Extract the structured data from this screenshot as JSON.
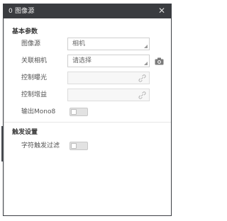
{
  "window": {
    "title": "0 图像源",
    "close_glyph": "✕",
    "titlebar_color": "#3a3c40"
  },
  "basic_params": {
    "section_title": "基本参数",
    "image_source": {
      "label": "图像源",
      "value": "相机"
    },
    "linked_camera": {
      "label": "关联相机",
      "value": "请选择",
      "action_icon": "camera-icon"
    },
    "exposure": {
      "label": "控制曝光",
      "value": "",
      "icon": "link-icon"
    },
    "gain": {
      "label": "控制增益",
      "value": "",
      "icon": "link-icon"
    },
    "output_mono8": {
      "label": "输出Mono8",
      "enabled": false
    }
  },
  "trigger_settings": {
    "section_title": "触发设置",
    "char_trigger_filter": {
      "label": "字符触发过滤",
      "enabled": false
    }
  }
}
